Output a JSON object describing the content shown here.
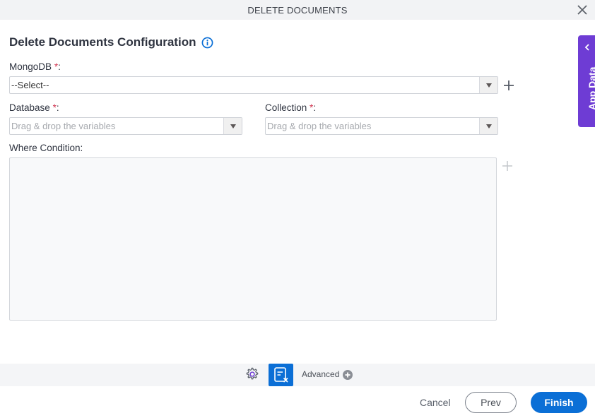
{
  "window": {
    "title": "DELETE DOCUMENTS",
    "close_icon": "close-icon"
  },
  "form": {
    "heading": "Delete Documents Configuration",
    "info_icon": "info-icon",
    "required_marker": "*",
    "mongodb": {
      "label": "MongoDB",
      "suffix": ":",
      "value": "--Select--"
    },
    "database": {
      "label": "Database",
      "suffix": ":",
      "placeholder": "Drag & drop the variables"
    },
    "collection": {
      "label": "Collection",
      "suffix": ":",
      "placeholder": "Drag & drop the variables"
    },
    "where_condition": {
      "label": "Where Condition:",
      "value": ""
    }
  },
  "side_panel": {
    "label": "App Data",
    "color": "#6e3cd4"
  },
  "toolbar": {
    "advanced_label": "Advanced"
  },
  "footer": {
    "cancel_label": "Cancel",
    "prev_label": "Prev",
    "finish_label": "Finish",
    "accent": "#0b6fd6"
  }
}
